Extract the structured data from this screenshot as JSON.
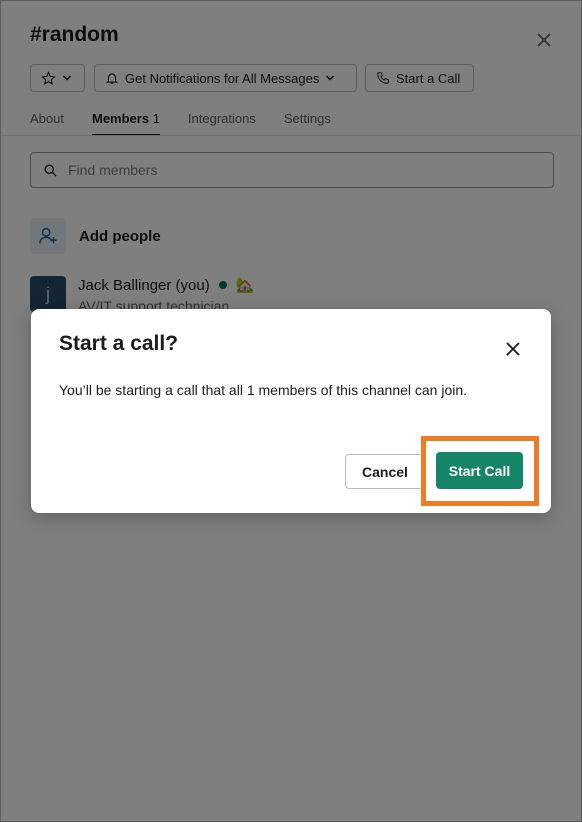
{
  "channel": {
    "title": "#random"
  },
  "toolbar": {
    "star_icon": "star-icon",
    "notifications_label": "Get Notifications for All Messages",
    "call_label": "Start a Call"
  },
  "tabs": [
    {
      "label": "About"
    },
    {
      "label": "Members",
      "count": "1"
    },
    {
      "label": "Integrations"
    },
    {
      "label": "Settings"
    }
  ],
  "search": {
    "placeholder": "Find members"
  },
  "add_people": {
    "label": "Add people"
  },
  "member": {
    "avatar_letter": "j",
    "name": "Jack Ballinger (you)",
    "status_emoji": "🏡",
    "role": "AV/IT support technician"
  },
  "modal": {
    "title": "Start a call?",
    "body": "You’ll be starting a call that all 1 members of this channel can join.",
    "cancel_label": "Cancel",
    "confirm_label": "Start Call"
  },
  "colors": {
    "confirm": "#148567",
    "highlight": "#ef7b27",
    "presence": "#007a5a"
  }
}
